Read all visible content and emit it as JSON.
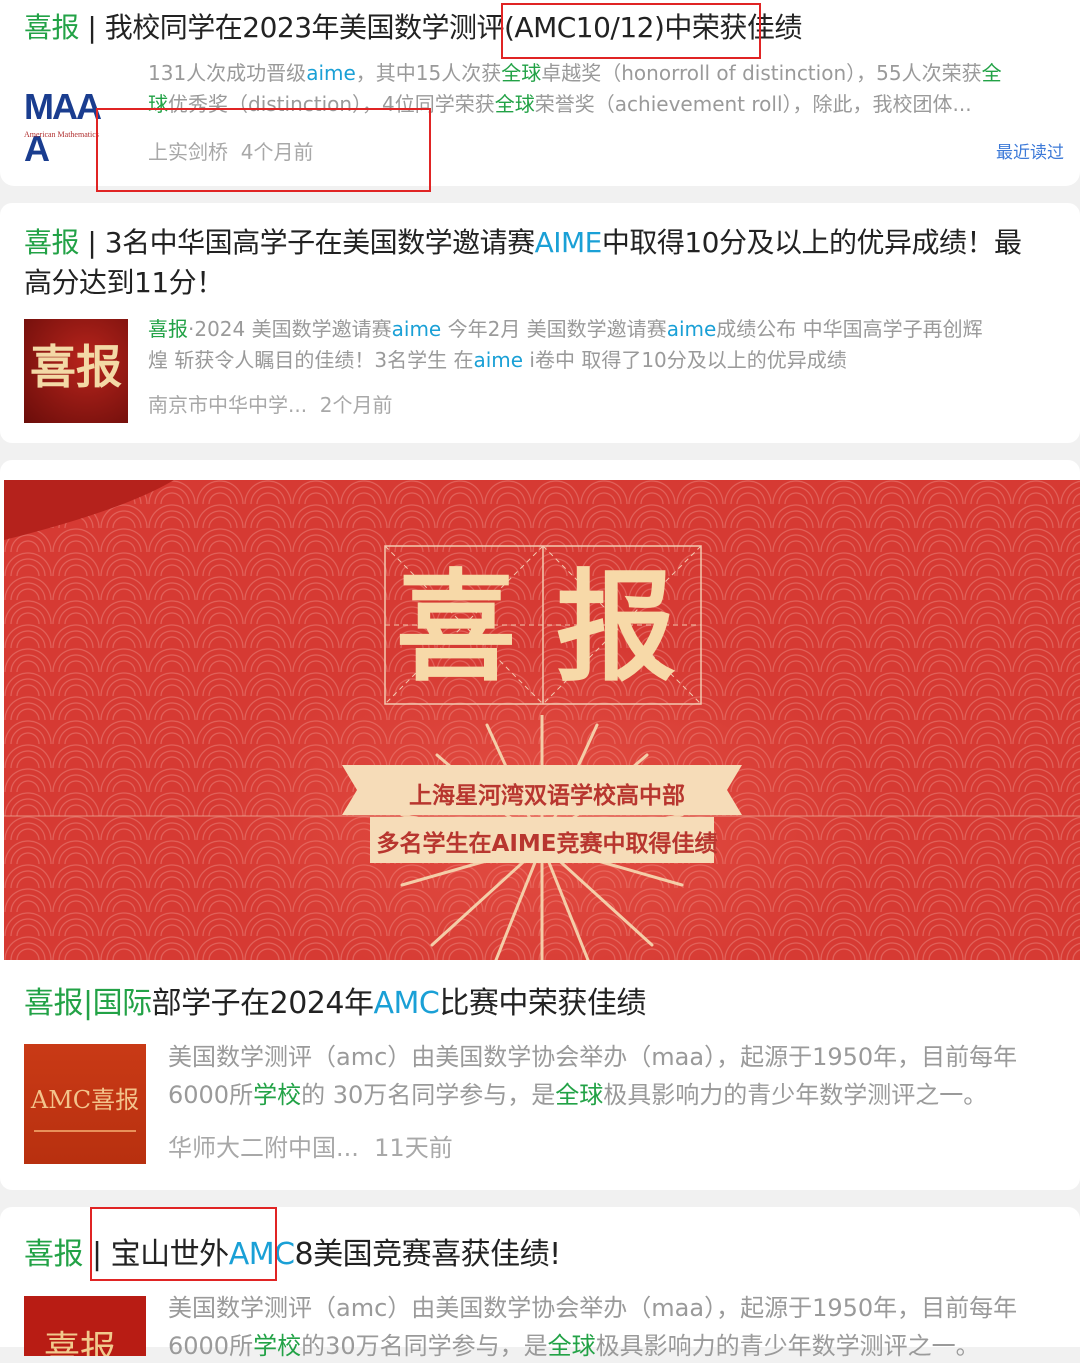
{
  "results": [
    {
      "title_prefix": "喜报",
      "title_rest": " | 我校同学在2023年美国数学测评(AMC10/12)中荣获佳绩",
      "snippet_line1_a": "131人次成功晋级",
      "snippet_line1_b": "aime",
      "snippet_line1_c": "，其中15人次获",
      "snippet_line1_d": "全球",
      "snippet_line1_e": "卓越奖（honorroll of distinction），55人次荣获",
      "snippet_line1_f": "全",
      "snippet_line2_a": "球",
      "snippet_line2_b": "优秀奖（distinction），4位同学荣获",
      "snippet_line2_c": "全球",
      "snippet_line2_d": "荣誉奖（achievement roll），除此，我校团体...",
      "thumb_logo": "MAA A",
      "thumb_sub": "American Mathematics",
      "source": "上实剑桥",
      "time": "4个月前",
      "recent": "最近读过"
    },
    {
      "title_prefix": "喜报",
      "title_line1_a": " | 3名中华国高学子在美国数学邀请赛",
      "title_line1_b": "AIME",
      "title_line1_c": "中取得10分及以上的优异成绩！最",
      "title_line2": "高分达到11分！",
      "snippet_line1_a": "喜报",
      "snippet_line1_b": "·2024 美国数学邀请赛",
      "snippet_line1_c": "aime",
      "snippet_line1_d": " 今年2月 美国数学邀请赛",
      "snippet_line1_e": "aime",
      "snippet_line1_f": "成绩公布 中华国高学子再创辉",
      "snippet_line2_a": "煌 斩获令人瞩目的佳绩！3名学生 在",
      "snippet_line2_b": "aime",
      "snippet_line2_c": " i卷中 取得了10分及以上的优异成绩",
      "thumb_text": "喜报",
      "source": "南京市中华中学...",
      "time": "2个月前"
    },
    {
      "banner_title_1": "喜",
      "banner_title_2": "报",
      "banner_line1": "上海星河湾双语学校高中部",
      "banner_line2": "多名学生在AIME竞赛中取得佳绩",
      "title_prefix": "喜报",
      "title_b1": "|国际",
      "title_c": "部学子在2024年",
      "title_b2": "AMC",
      "title_d": "比赛中荣获佳绩",
      "snippet_line1": "美国数学测评（amc）由美国数学协会举办（maa），起源于1950年，目前每年",
      "snippet_line2_a": "6000所",
      "snippet_line2_b": "学校",
      "snippet_line2_c": "的 30万名同学参与，是",
      "snippet_line2_d": "全球",
      "snippet_line2_e": "极具影响力的青少年数学测评之一。",
      "thumb_text": "AMC喜报",
      "source": "华师大二附中国...",
      "time": "11天前"
    },
    {
      "title_prefix": "喜报",
      "title_a": " | 宝山世外",
      "title_b": "AMC",
      "title_c": "8美国竞赛喜获佳绩!",
      "snippet_line1": "美国数学测评（amc）由美国数学协会举办（maa），起源于1950年，目前每年",
      "snippet_line2_a": "6000所",
      "snippet_line2_b": "学校",
      "snippet_line2_c": "的30万名同学参与，是",
      "snippet_line2_d": "全球",
      "snippet_line2_e": "极具影响力的青少年数学测评之一。",
      "thumb_text": "喜报"
    }
  ],
  "colors": {
    "green": "#22a246",
    "blue": "#1aa0d6",
    "highlight": "#e02424",
    "banner_red": "#d63a33"
  }
}
